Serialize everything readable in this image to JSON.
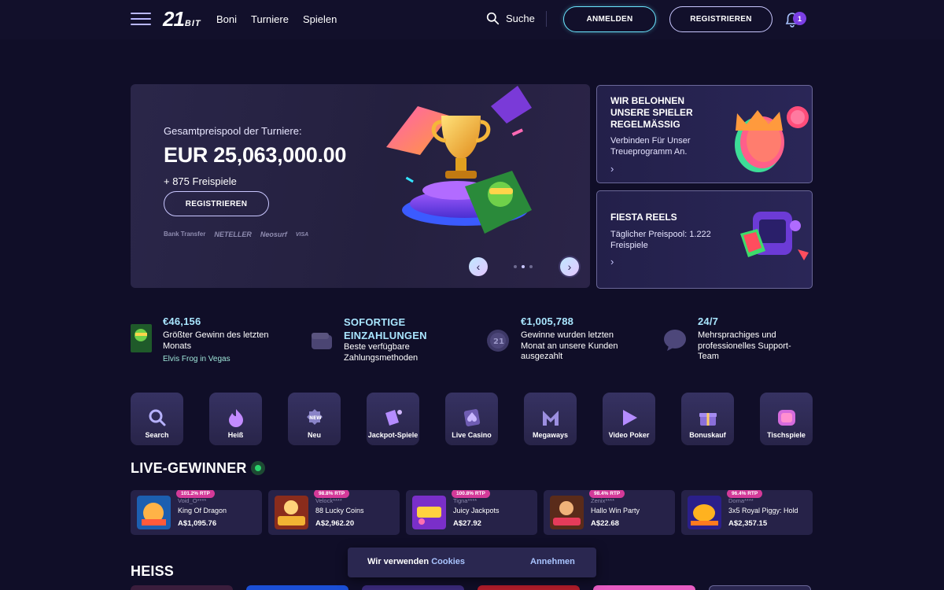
{
  "header": {
    "logo_main": "21",
    "logo_sub": "BIT",
    "nav": [
      "Boni",
      "Turniere",
      "Spielen"
    ],
    "search_label": "Suche",
    "login_label": "ANMELDEN",
    "register_label": "REGISTRIEREN",
    "notification_count": "1"
  },
  "hero": {
    "label": "Gesamtpreispool der Turniere:",
    "amount": "EUR 25,063,000.00",
    "spins": "+ 875 Freispiele",
    "cta": "REGISTRIEREN",
    "payments": [
      "Bank Transfer",
      "NETELLER",
      "Neosurf",
      "VISA"
    ],
    "slides_total": 3,
    "active_slide": 2
  },
  "promos": [
    {
      "title": "WIR BELOHNEN UNSERE SPIELER REGELMÄSSIG",
      "desc": "Verbinden Für Unser Treueprogramm An."
    },
    {
      "title": "FIESTA REELS",
      "desc": "Täglicher Preispool: 1.222 Freispiele"
    }
  ],
  "stats": [
    {
      "value": "€46,156",
      "text": "Größter Gewinn des letzten Monats",
      "sub": "Elvis Frog in Vegas"
    },
    {
      "value": "SOFORTIGE EINZAHLUNGEN",
      "text": "Beste verfügbare Zahlungsmethoden"
    },
    {
      "value": "€1,005,788",
      "text": "Gewinne wurden letzten Monat an unsere Kunden ausgezahlt"
    },
    {
      "value": "24/7",
      "text": "Mehrsprachiges und professionelles Support-Team"
    }
  ],
  "categories": [
    {
      "label": "Search",
      "icon": "search-icon"
    },
    {
      "label": "Heiß",
      "icon": "flame-icon"
    },
    {
      "label": "Neu",
      "icon": "new-badge-icon"
    },
    {
      "label": "Jackpot-Spiele",
      "icon": "jackpot-icon"
    },
    {
      "label": "Live Casino",
      "icon": "spade-card-icon"
    },
    {
      "label": "Megaways",
      "icon": "megaways-icon"
    },
    {
      "label": "Video Poker",
      "icon": "play-icon"
    },
    {
      "label": "Bonuskauf",
      "icon": "gift-icon"
    },
    {
      "label": "Tischspiele",
      "icon": "table-game-icon"
    }
  ],
  "live_winners_title": "LIVE-GEWINNER",
  "winners": [
    {
      "rtp": "101.2% RTP",
      "user": "Void_O****",
      "game": "King Of Dragon",
      "amount": "A$1,095.76"
    },
    {
      "rtp": "98.8% RTP",
      "user": "Velock****",
      "game": "88 Lucky Coins",
      "amount": "A$2,962.20"
    },
    {
      "rtp": "100.8% RTP",
      "user": "Tigna****",
      "game": "Juicy Jackpots",
      "amount": "A$27.92"
    },
    {
      "rtp": "98.4% RTP",
      "user": "Zenix****",
      "game": "Hallo Win Party",
      "amount": "A$22.68"
    },
    {
      "rtp": "96.4% RTP",
      "user": "Doma****",
      "game": "3x5 Royal Piggy: Hold",
      "amount": "A$2,357.15"
    }
  ],
  "heiss_title": "HEISS",
  "cookie": {
    "message": "Wir verwenden",
    "link": "Cookies",
    "accept": "Annehmen"
  },
  "colors": {
    "background": "#100e28",
    "accent_cyan": "#a9e6ff",
    "rtp_pink": "#d43a99",
    "live_green": "#2bd46d"
  }
}
